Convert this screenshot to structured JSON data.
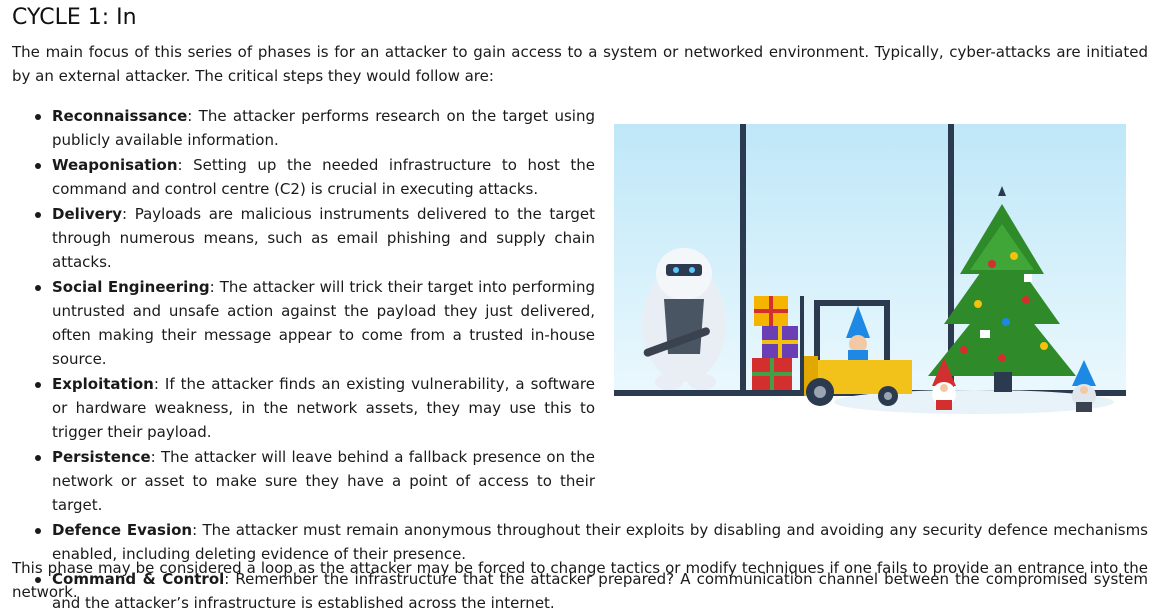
{
  "title": "CYCLE 1: In",
  "intro": "The main focus of this series of phases is for an attacker to gain access to a system or networked environment. Typically, cyber-attacks are initiated by an external attacker. The critical steps they would follow are:",
  "steps": [
    {
      "term": "Reconnaissance",
      "text": ": The attacker performs research on the target using publicly available information."
    },
    {
      "term": "Weaponisation",
      "text": ": Setting up the needed infrastructure to host the command and control centre (C2) is crucial in executing attacks."
    },
    {
      "term": "Delivery",
      "text": ": Payloads are malicious instruments delivered to the target through numerous means, such as email phishing and supply chain attacks."
    },
    {
      "term": "Social Engineering",
      "text": ": The attacker will trick their target into performing untrusted and unsafe action against the payload they just delivered, often making their message appear to come from a trusted in-house source."
    },
    {
      "term": "Exploitation",
      "text": ": If the attacker finds an existing vulnerability, a software or hardware weakness, in the network assets, they may use this to trigger their payload."
    },
    {
      "term": "Persistence",
      "text": ": The attacker will leave behind a fallback presence on the network or asset to make sure they have a point of access to their target."
    },
    {
      "term": "Defence Evasion",
      "text": ": The attacker must remain anonymous throughout their exploits by disabling and avoiding any security defence mechanisms enabled, including deleting evidence of their presence."
    },
    {
      "term": "Command & Control",
      "text": ": Remember the infrastructure that the attacker prepared? A communication channel between the compromised system and the attacker’s infrastructure is established across the internet."
    }
  ],
  "outro": "This phase may be considered a loop as the attacker may be forced to change tactics or modify techniques if one fails to provide an entrance into the network.",
  "colors": {
    "sky": "#d9f1fb",
    "frame": "#2b3a4e",
    "tree": "#2f8a2a",
    "forklift": "#f2c21a",
    "text": "#1a1a1a"
  }
}
